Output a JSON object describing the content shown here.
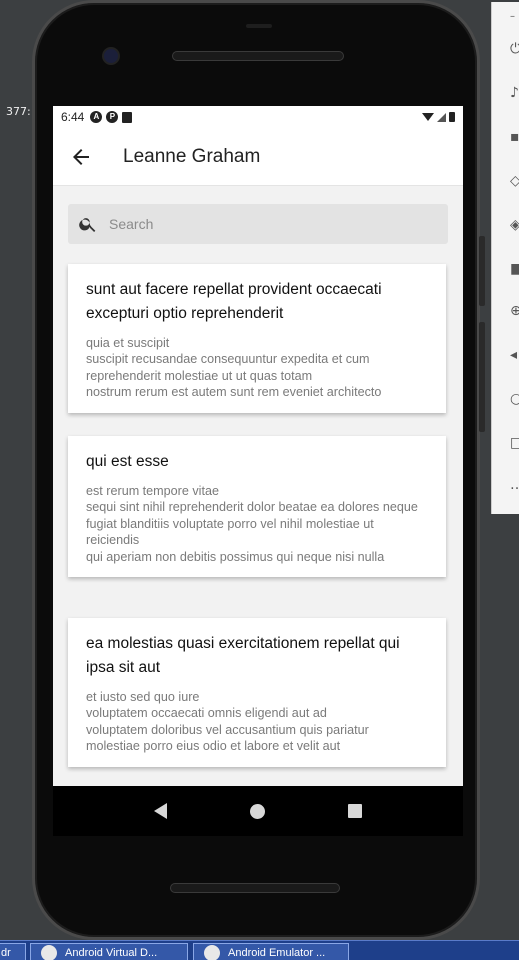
{
  "desktop": {
    "left_text": "377:"
  },
  "status_bar": {
    "time": "6:44"
  },
  "app_bar": {
    "title": "Leanne Graham"
  },
  "search": {
    "placeholder": "Search",
    "value": ""
  },
  "posts": [
    {
      "title": "sunt aut facere repellat provident occaecati excepturi optio reprehenderit",
      "body": "quia et suscipit\nsuscipit recusandae consequuntur expedita et cum reprehenderit molestiae ut ut quas totam\nnostrum rerum est autem sunt rem eveniet architecto"
    },
    {
      "title": "qui est esse",
      "body": "est rerum tempore vitae\nsequi sint nihil reprehenderit dolor beatae ea dolores neque\nfugiat blanditiis voluptate porro vel nihil molestiae ut reiciendis\nqui aperiam non debitis possimus qui neque nisi nulla"
    },
    {
      "title": "ea molestias quasi exercitationem repellat qui ipsa sit aut",
      "body": "et iusto sed quo iure\nvoluptatem occaecati omnis eligendi aut ad\nvoluptatem doloribus vel accusantium quis pariatur\nmolestiae porro eius odio et labore et velit aut"
    }
  ],
  "taskbar": {
    "items": [
      {
        "label": "dr"
      },
      {
        "label": "Android Virtual D..."
      },
      {
        "label": "Android Emulator ..."
      }
    ]
  },
  "icons": {
    "back": "arrow-left-icon",
    "search": "magnifier-icon",
    "nav_back": "triangle-back-icon",
    "nav_home": "circle-home-icon",
    "nav_recent": "square-recents-icon"
  }
}
